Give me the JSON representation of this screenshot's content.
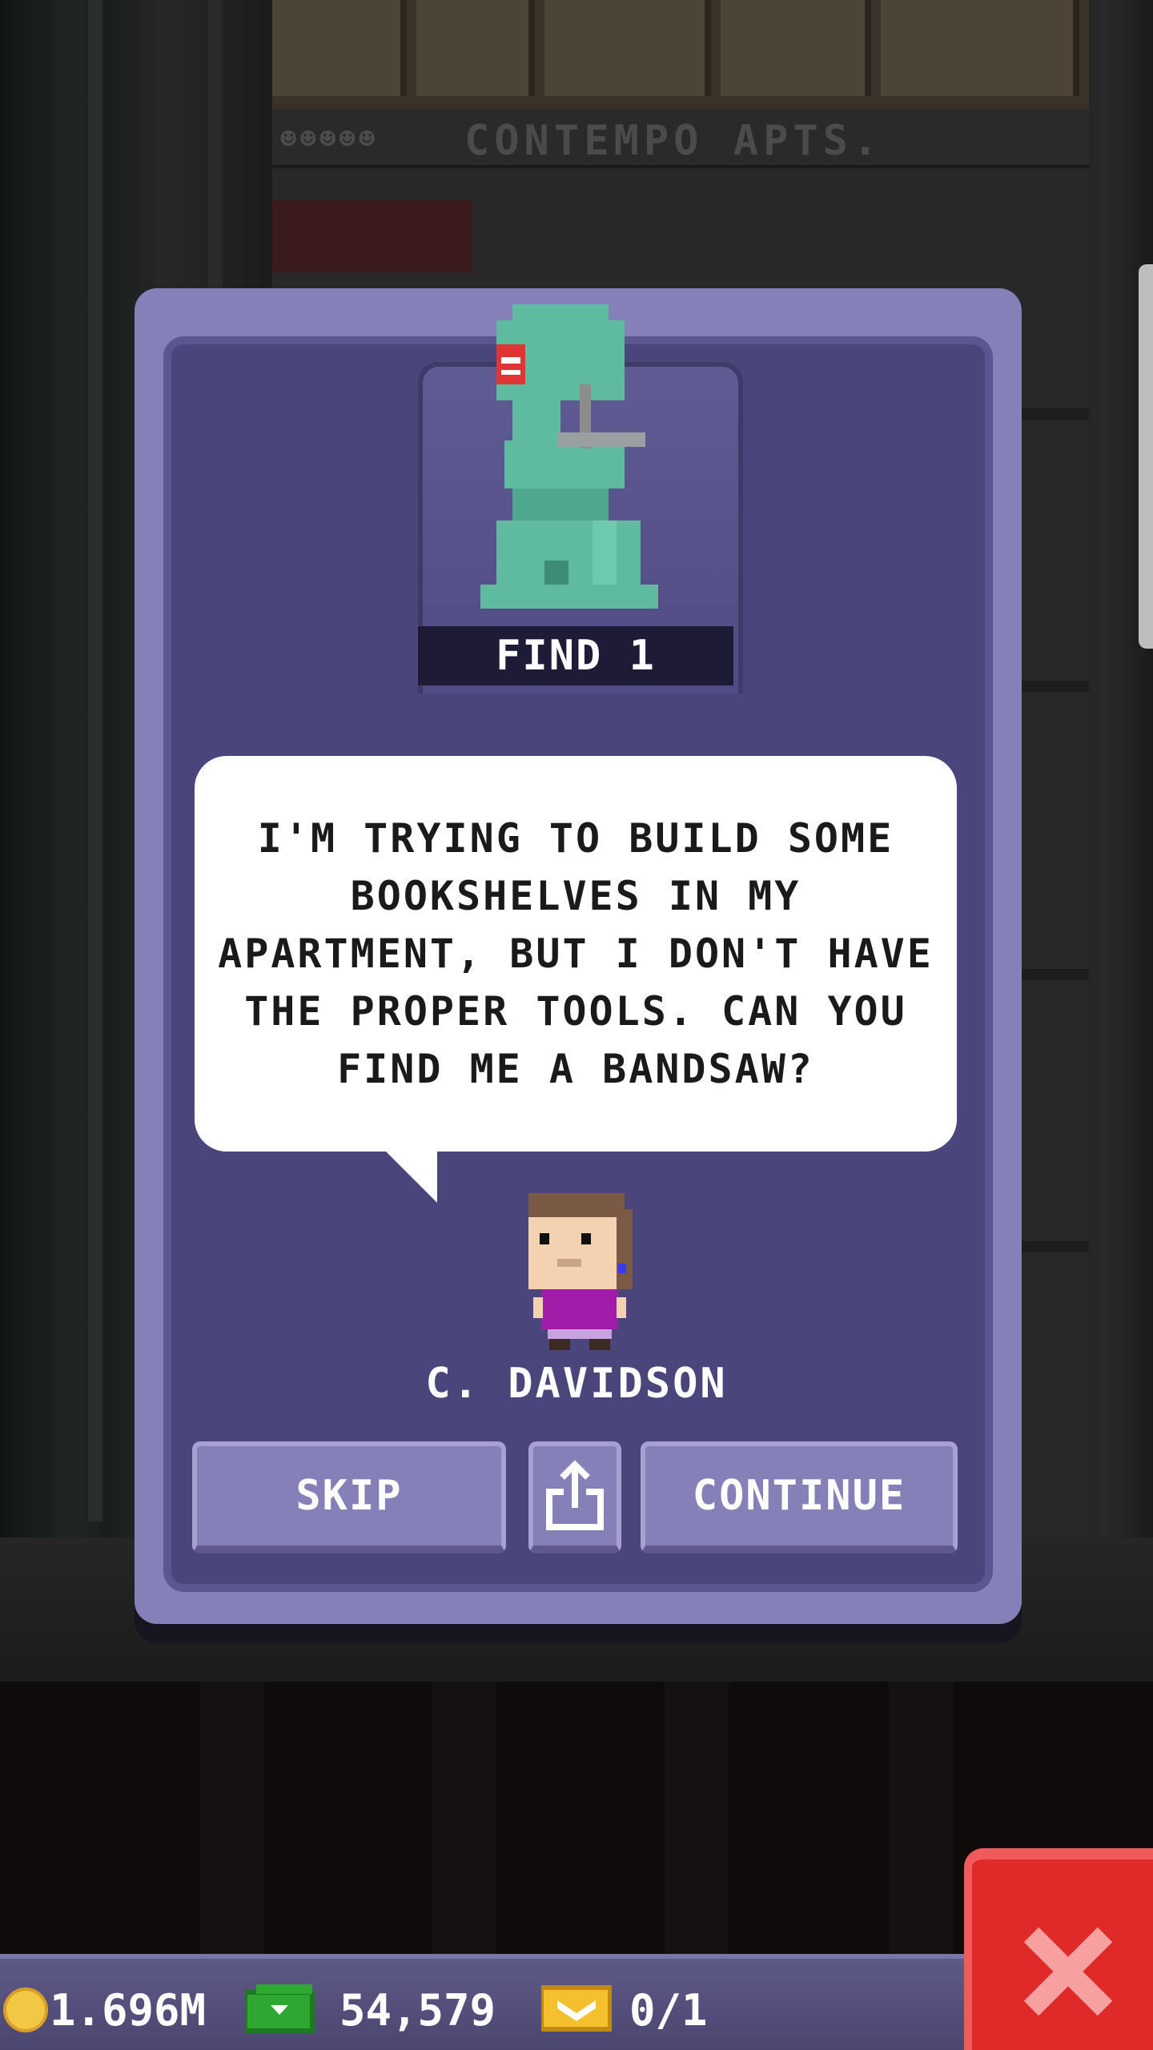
{
  "background": {
    "building_sign": "CONTEMPO APTS.",
    "sign_people": "☻☻☻☻☻"
  },
  "quest": {
    "objective_label": "FIND 1",
    "item_icon": "bandsaw-icon",
    "message": "I'M TRYING TO BUILD SOME BOOKSHELVES IN MY APARTMENT, BUT I DON'T HAVE THE PROPER TOOLS. CAN YOU FIND ME A BANDSAW?",
    "npc_name": "C. DAVIDSON",
    "skip_label": "SKIP",
    "share_icon": "share-icon",
    "continue_label": "CONTINUE"
  },
  "hud": {
    "coins": "1.696M",
    "bux": "54,579",
    "tickets": "0/1",
    "coin_icon": "coin-icon",
    "bux_icon": "cash-icon",
    "ticket_icon": "golden-ticket-icon"
  },
  "close_icon": "close-icon",
  "colors": {
    "dialog_frame": "#8680b8",
    "dialog_panel": "#4a457a",
    "close_button": "#e02a2a",
    "item_color": "#5fbba0"
  }
}
